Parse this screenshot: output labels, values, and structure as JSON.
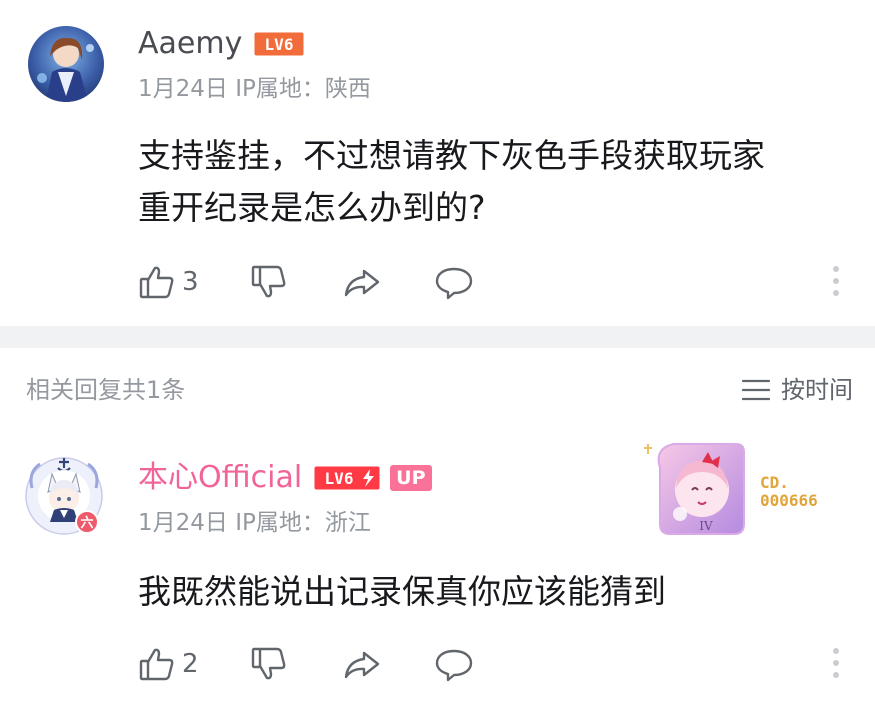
{
  "comment": {
    "username": "Aaemy",
    "level": "LV6",
    "date": "1月24日",
    "ip_label": "IP属地：",
    "ip_region": "陕西",
    "text_line1": "支持鉴挂，不过想请教下灰色手段获取玩家",
    "text_line2": "重开纪录是怎么办到的?",
    "like_count": "3"
  },
  "reply_section": {
    "count_label": "相关回复共1条",
    "sort_label": "按时间"
  },
  "reply": {
    "username": "本心Official",
    "level": "LV6",
    "up_badge": "UP",
    "date": "1月24日",
    "ip_label": "IP属地：",
    "ip_region": "浙江",
    "text": "我既然能说出记录保真你应该能猜到",
    "like_count": "2",
    "fan_number_line1": "CD.",
    "fan_number_line2": "000666",
    "fan_card_rank": "IV",
    "avatar_badge": "六"
  },
  "colors": {
    "level_badge": "#f26b3a",
    "level_badge_hardcore": "#ff3a44",
    "pink_name": "#f0649a",
    "up_badge": "#fb7299",
    "meta_gray": "#9499a0",
    "divider": "#f1f2f3"
  },
  "icons": [
    "thumbs-up-icon",
    "thumbs-down-icon",
    "share-icon",
    "comment-icon",
    "more-vertical-icon",
    "sort-lines-icon"
  ]
}
